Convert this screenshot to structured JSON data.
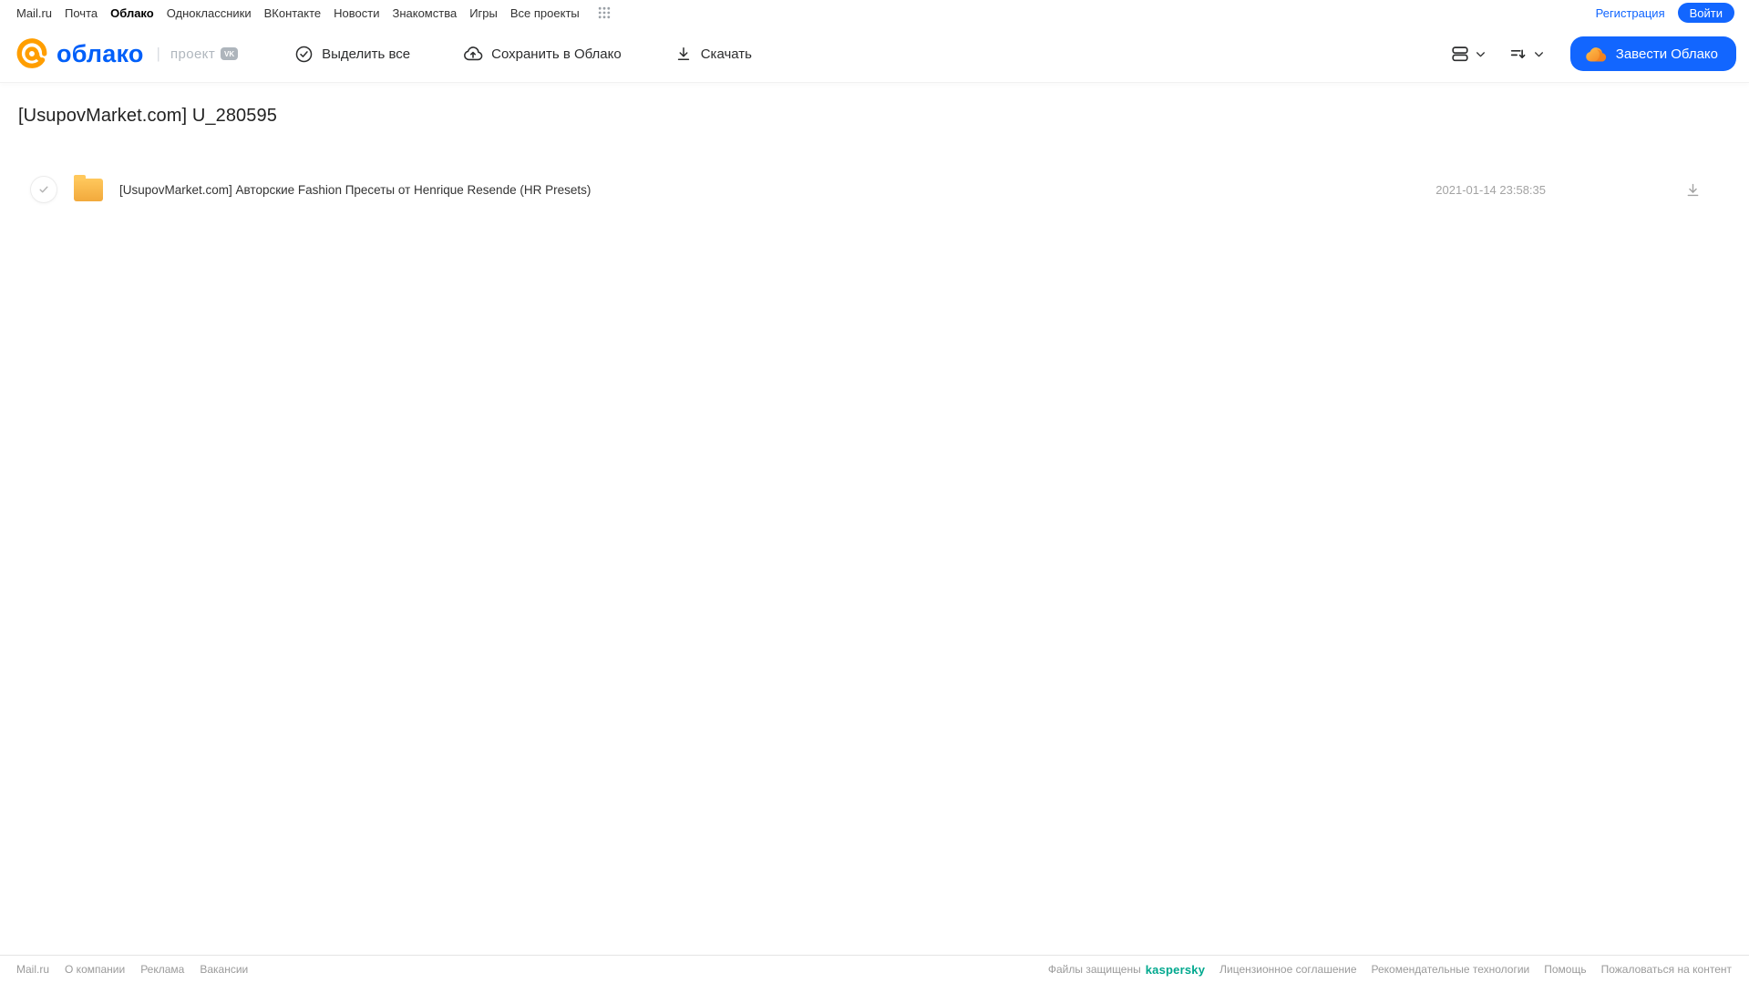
{
  "colors": {
    "accent_blue": "#1266ff",
    "logo_blue": "#005ff9",
    "logo_orange": "#ff9e00",
    "folder_amber": "#f2a93c",
    "folder_amber_light": "#ffc85c",
    "kaspersky_green": "#00a88e"
  },
  "topnav": {
    "items": [
      "Mail.ru",
      "Почта",
      "Облако",
      "Одноклассники",
      "ВКонтакте",
      "Новости",
      "Знакомства",
      "Игры",
      "Все проекты"
    ],
    "registration_label": "Регистрация",
    "login_label": "Войти"
  },
  "header": {
    "logo_text": "облако",
    "project_label": "проект",
    "vk_badge": "VK",
    "toolbar": {
      "select_all": "Выделить все",
      "save_to_cloud": "Сохранить в Облако",
      "download": "Скачать"
    },
    "get_cloud_label": "Завести Облако"
  },
  "page": {
    "title": "[UsupovMarket.com] U_280595"
  },
  "file_list": {
    "rows": [
      {
        "name": "[UsupovMarket.com] Авторские Fashion Пресеты от Henrique Resende (HR Presets)",
        "date": "2021-01-14 23:58:35"
      }
    ]
  },
  "footer": {
    "left_links": [
      "Mail.ru",
      "О компании",
      "Реклама",
      "Вакансии"
    ],
    "protected_text": "Файлы защищены",
    "kaspersky_label": "kaspersky",
    "right_links": [
      "Лицензионное соглашение",
      "Рекомендательные технологии",
      "Помощь",
      "Пожаловаться на контент"
    ]
  }
}
